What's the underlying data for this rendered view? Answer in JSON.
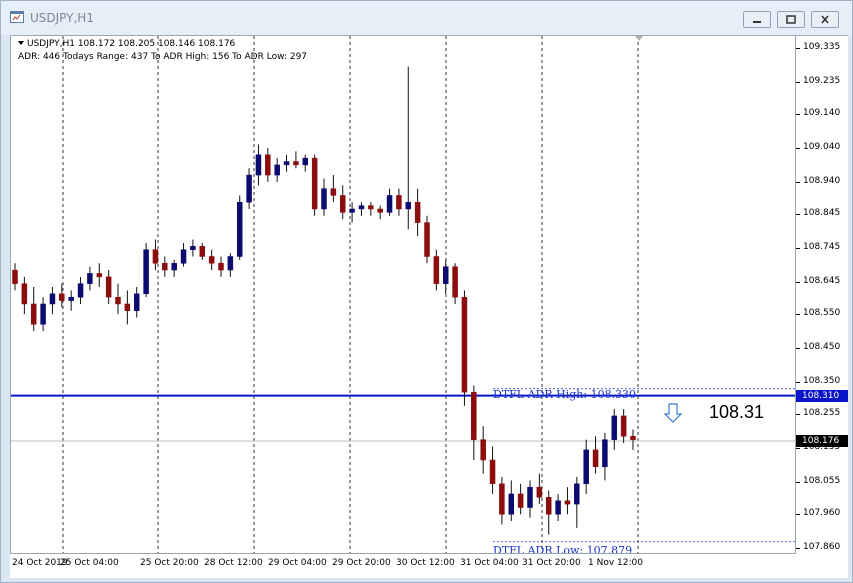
{
  "window": {
    "title": "USDJPY,H1"
  },
  "header": {
    "line1": "USDJPY,H1  108.172 108.205 108.146 108.176",
    "line2": "ADR: 446  Todays Range: 437  To ADR High: 156  To ADR Low: 297"
  },
  "price_axis": {
    "labels": [
      "109.335",
      "109.235",
      "109.140",
      "109.040",
      "108.940",
      "108.845",
      "108.745",
      "108.645",
      "108.550",
      "108.450",
      "108.350",
      "108.255",
      "108.155",
      "108.055",
      "107.960",
      "107.860"
    ],
    "high_tag": "108.310",
    "current_tag": "108.176"
  },
  "time_axis": {
    "labels": [
      "24 Oct 2019",
      "25 Oct 04:00",
      "25 Oct 20:00",
      "28 Oct 12:00",
      "29 Oct 04:00",
      "29 Oct 20:00",
      "30 Oct 12:00",
      "31 Oct 04:00",
      "31 Oct 20:00",
      "1 Nov 12:00"
    ]
  },
  "lines": {
    "adr_high_label": "DTFL ADR High: 108.330",
    "adr_low_label": "DTFL ADR Low: 107.879",
    "big_price": "108.31"
  },
  "colors": {
    "bull": "#0b0b70",
    "bear": "#8b0d0d",
    "adr_line": "#0a14c8",
    "accent": "#1a33cc"
  },
  "chart_data": {
    "type": "candlestick",
    "title": "USDJPY,H1",
    "ylim": [
      107.84,
      109.37
    ],
    "y_ticks": [
      109.335,
      109.235,
      109.14,
      109.04,
      108.94,
      108.845,
      108.745,
      108.645,
      108.55,
      108.45,
      108.35,
      108.255,
      108.155,
      108.055,
      107.96,
      107.86
    ],
    "current_price": 108.176,
    "adr_high": 108.33,
    "adr_high_line": 108.31,
    "adr_low": 107.879,
    "ohlc": [
      [
        108.68,
        108.7,
        108.62,
        108.64
      ],
      [
        108.64,
        108.66,
        108.55,
        108.58
      ],
      [
        108.58,
        108.63,
        108.5,
        108.52
      ],
      [
        108.52,
        108.6,
        108.5,
        108.58
      ],
      [
        108.58,
        108.63,
        108.55,
        108.61
      ],
      [
        108.61,
        108.64,
        108.57,
        108.59
      ],
      [
        108.59,
        108.62,
        108.56,
        108.6
      ],
      [
        108.6,
        108.66,
        108.58,
        108.64
      ],
      [
        108.64,
        108.69,
        108.62,
        108.67
      ],
      [
        108.67,
        108.7,
        108.63,
        108.66
      ],
      [
        108.66,
        108.68,
        108.58,
        108.6
      ],
      [
        108.6,
        108.64,
        108.55,
        108.58
      ],
      [
        108.58,
        108.62,
        108.52,
        108.56
      ],
      [
        108.56,
        108.63,
        108.54,
        108.61
      ],
      [
        108.61,
        108.76,
        108.6,
        108.74
      ],
      [
        108.74,
        108.77,
        108.68,
        108.7
      ],
      [
        108.7,
        108.72,
        108.66,
        108.68
      ],
      [
        108.68,
        108.71,
        108.66,
        108.7
      ],
      [
        108.7,
        108.76,
        108.69,
        108.74
      ],
      [
        108.74,
        108.77,
        108.72,
        108.75
      ],
      [
        108.75,
        108.76,
        108.71,
        108.72
      ],
      [
        108.72,
        108.74,
        108.68,
        108.7
      ],
      [
        108.7,
        108.72,
        108.66,
        108.68
      ],
      [
        108.68,
        108.73,
        108.66,
        108.72
      ],
      [
        108.72,
        108.9,
        108.71,
        108.88
      ],
      [
        108.88,
        108.98,
        108.86,
        108.96
      ],
      [
        108.96,
        109.05,
        108.93,
        109.02
      ],
      [
        109.02,
        109.04,
        108.94,
        108.96
      ],
      [
        108.96,
        109.01,
        108.94,
        108.99
      ],
      [
        108.99,
        109.02,
        108.97,
        109.0
      ],
      [
        109.0,
        109.03,
        108.98,
        108.99
      ],
      [
        108.99,
        109.02,
        108.97,
        109.01
      ],
      [
        109.01,
        109.02,
        108.84,
        108.86
      ],
      [
        108.86,
        108.95,
        108.84,
        108.92
      ],
      [
        108.92,
        108.96,
        108.88,
        108.9
      ],
      [
        108.9,
        108.93,
        108.83,
        108.85
      ],
      [
        108.85,
        108.88,
        108.82,
        108.86
      ],
      [
        108.86,
        108.88,
        108.84,
        108.87
      ],
      [
        108.87,
        108.88,
        108.84,
        108.86
      ],
      [
        108.86,
        108.87,
        108.83,
        108.85
      ],
      [
        108.85,
        108.92,
        108.84,
        108.9
      ],
      [
        108.9,
        108.92,
        108.84,
        108.86
      ],
      [
        108.86,
        109.28,
        108.8,
        108.88
      ],
      [
        108.88,
        108.92,
        108.78,
        108.82
      ],
      [
        108.82,
        108.84,
        108.7,
        108.72
      ],
      [
        108.72,
        108.74,
        108.62,
        108.64
      ],
      [
        108.64,
        108.71,
        108.61,
        108.69
      ],
      [
        108.69,
        108.7,
        108.58,
        108.6
      ],
      [
        108.6,
        108.62,
        108.28,
        108.32
      ],
      [
        108.32,
        108.34,
        108.12,
        108.18
      ],
      [
        108.18,
        108.22,
        108.08,
        108.12
      ],
      [
        108.12,
        108.16,
        108.02,
        108.05
      ],
      [
        108.05,
        108.07,
        107.93,
        107.96
      ],
      [
        107.96,
        108.06,
        107.94,
        108.02
      ],
      [
        108.02,
        108.05,
        107.96,
        107.98
      ],
      [
        107.98,
        108.06,
        107.95,
        108.04
      ],
      [
        108.04,
        108.08,
        107.99,
        108.01
      ],
      [
        108.01,
        108.03,
        107.9,
        107.96
      ],
      [
        107.96,
        108.02,
        107.94,
        108.0
      ],
      [
        108.0,
        108.04,
        107.96,
        107.99
      ],
      [
        107.99,
        108.07,
        107.92,
        108.05
      ],
      [
        108.05,
        108.18,
        108.02,
        108.15
      ],
      [
        108.15,
        108.19,
        108.08,
        108.1
      ],
      [
        108.1,
        108.2,
        108.06,
        108.18
      ],
      [
        108.18,
        108.27,
        108.15,
        108.25
      ],
      [
        108.25,
        108.27,
        108.17,
        108.19
      ],
      [
        108.19,
        108.21,
        108.15,
        108.18
      ]
    ]
  }
}
